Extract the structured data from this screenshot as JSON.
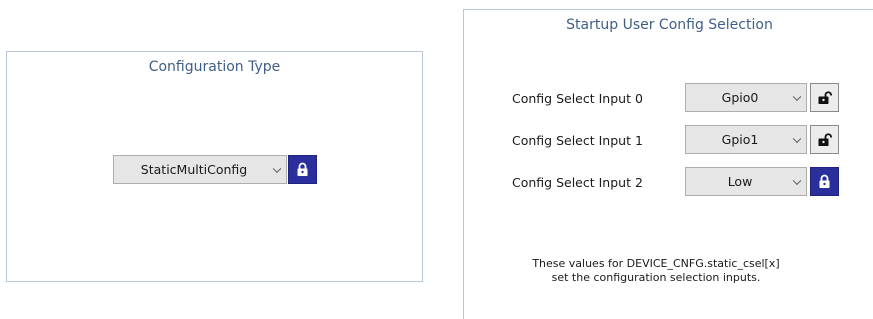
{
  "config_type": {
    "title": "Configuration Type",
    "dropdown_value": "StaticMultiConfig",
    "lock_state": "locked"
  },
  "startup": {
    "title": "Startup User Config Selection",
    "rows": [
      {
        "label": "Config Select Input 0",
        "value": "Gpio0",
        "lock_state": "unlocked"
      },
      {
        "label": "Config Select Input 1",
        "value": "Gpio1",
        "lock_state": "unlocked"
      },
      {
        "label": "Config Select Input 2",
        "value": "Low",
        "lock_state": "locked"
      }
    ],
    "note_line1": "These values for DEVICE_CNFG.static_csel[x]",
    "note_line2": "set the configuration selection inputs."
  },
  "colors": {
    "title_text": "#3f5f86",
    "locked_button": "#2a2f9c",
    "panel_border": "#b8c8d8"
  },
  "icons": {
    "locked": "lock-closed-icon",
    "unlocked": "lock-open-icon",
    "dropdown": "chevron-down-icon"
  }
}
